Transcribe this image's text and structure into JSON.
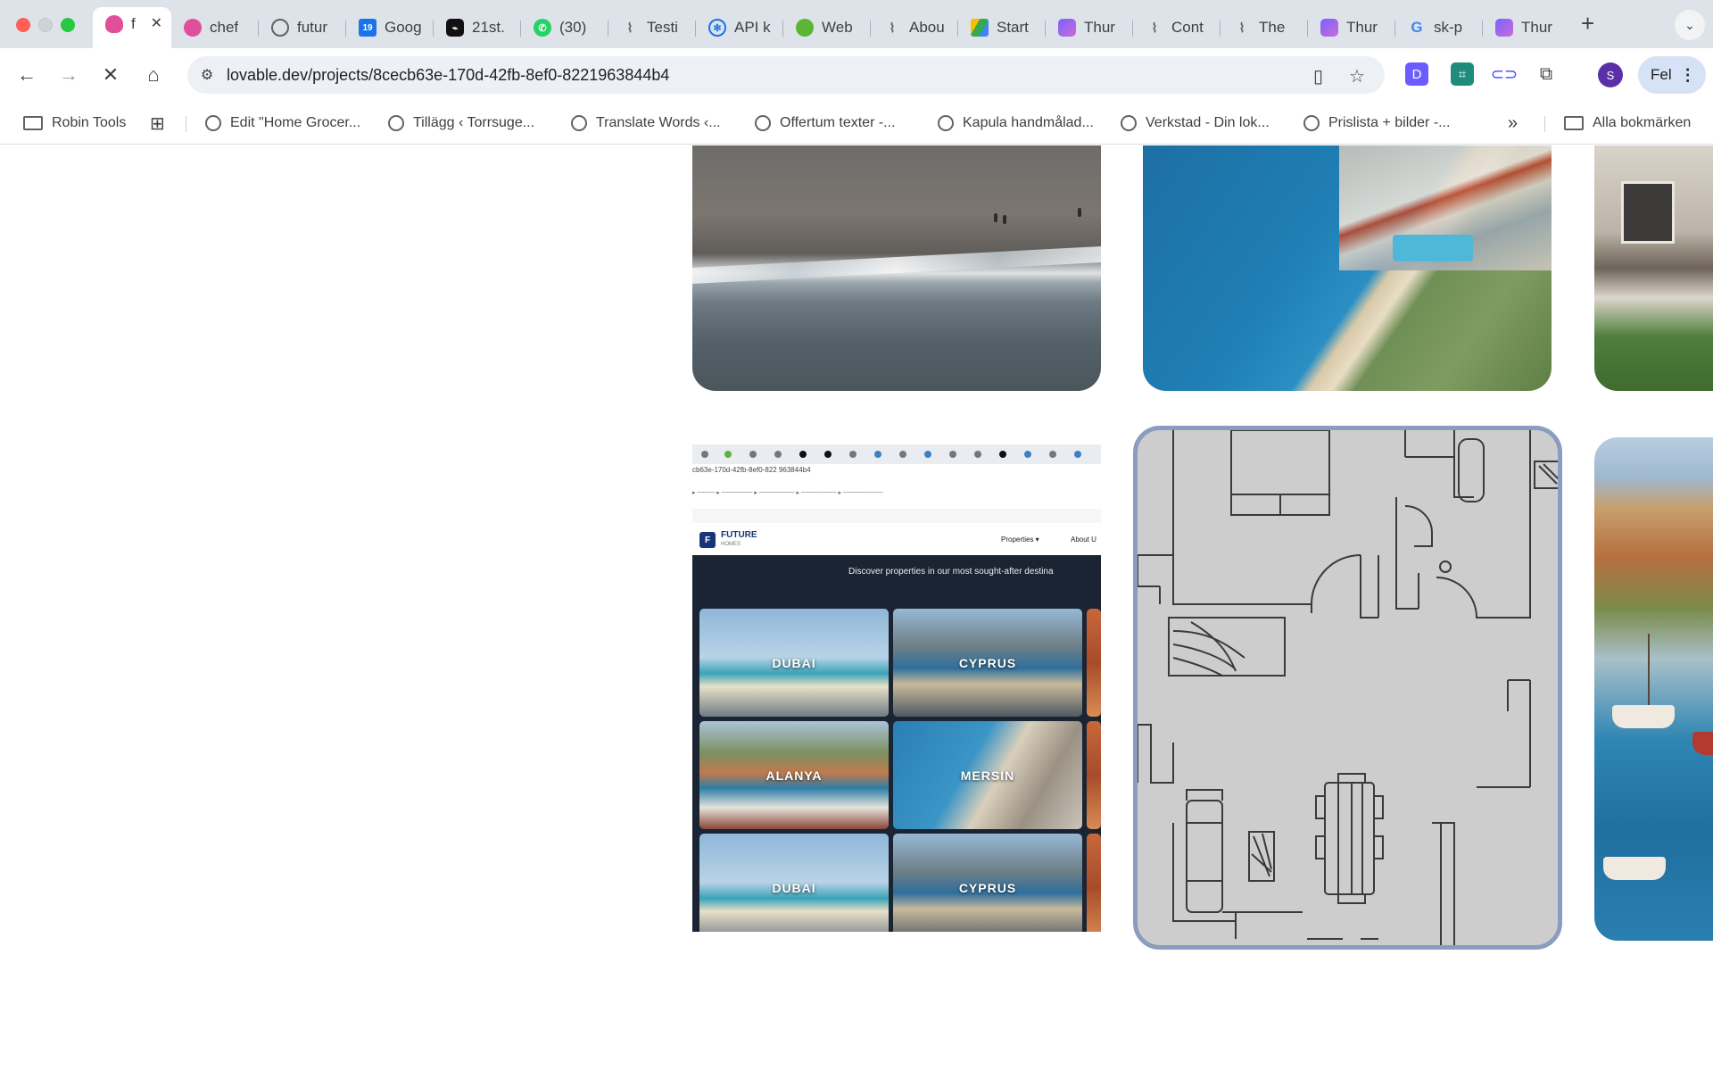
{
  "window": {
    "tabs": [
      {
        "title": "f",
        "icon": "lovable-heart-icon",
        "color": "#e0509a",
        "active": true
      },
      {
        "title": "chef",
        "icon": "lovable-heart-icon",
        "color": "#e0509a"
      },
      {
        "title": "futur",
        "icon": "globe-icon",
        "color": "#5f6368"
      },
      {
        "title": "Goog",
        "icon": "calendar-icon",
        "color": "#1a73e8"
      },
      {
        "title": "21st.",
        "icon": "twentyfirst-icon",
        "color": "#111111"
      },
      {
        "title": "(30)",
        "icon": "whatsapp-icon",
        "color": "#25d366"
      },
      {
        "title": "Testi",
        "icon": "bolt-icon",
        "color": "#5f6368"
      },
      {
        "title": "API k",
        "icon": "openai-icon",
        "color": "#1a73e8"
      },
      {
        "title": "Web",
        "icon": "green-dot-icon",
        "color": "#34a853"
      },
      {
        "title": "Abou",
        "icon": "bolt-icon",
        "color": "#5f6368"
      },
      {
        "title": "Start",
        "icon": "google-drive-icon",
        "color": "#fbbc04"
      },
      {
        "title": "Thur",
        "icon": "make-icon",
        "color": "#7b61ff"
      },
      {
        "title": "Cont",
        "icon": "bolt-icon",
        "color": "#5f6368"
      },
      {
        "title": "The",
        "icon": "bolt-icon",
        "color": "#5f6368"
      },
      {
        "title": "Thur",
        "icon": "make-icon",
        "color": "#7b61ff"
      },
      {
        "title": "sk-p",
        "icon": "google-icon",
        "color": "#4285f4"
      },
      {
        "title": "Thur",
        "icon": "make-icon",
        "color": "#7b61ff"
      }
    ],
    "new_tab_label": "+",
    "tab_close_label": "✕"
  },
  "toolbar": {
    "url": "lovable.dev/projects/8cecb63e-170d-42fb-8ef0-8221963844b4",
    "profile_label": "Fel",
    "avatar_letter": "S"
  },
  "bookmarks": {
    "apps_label": "Robin Tools",
    "items": [
      "Edit \"Home Grocer...",
      "Tillägg ‹ Torrsuge...",
      "Translate Words ‹...",
      "Offertum texter -...",
      "Kapula handmålad...",
      "Verkstad - Din lok...",
      "Prislista + bilder -..."
    ],
    "overflow_label": "»",
    "all_bookmarks_label": "Alla bokmärken"
  },
  "content": {
    "mini_site": {
      "url": "cb63e-170d-42fb-8ef0-822 963844b4",
      "logo_letter": "F",
      "brand": "FUTURE",
      "brand_sub": "HOMES",
      "nav_1": "Properties ▾",
      "nav_2": "About U",
      "tagline": "Discover properties in our most sought-after destina",
      "tiles": [
        "DUBAI",
        "CYPRUS",
        "ALANYA",
        "MERSIN",
        "DUBAI",
        "CYPRUS"
      ]
    }
  }
}
